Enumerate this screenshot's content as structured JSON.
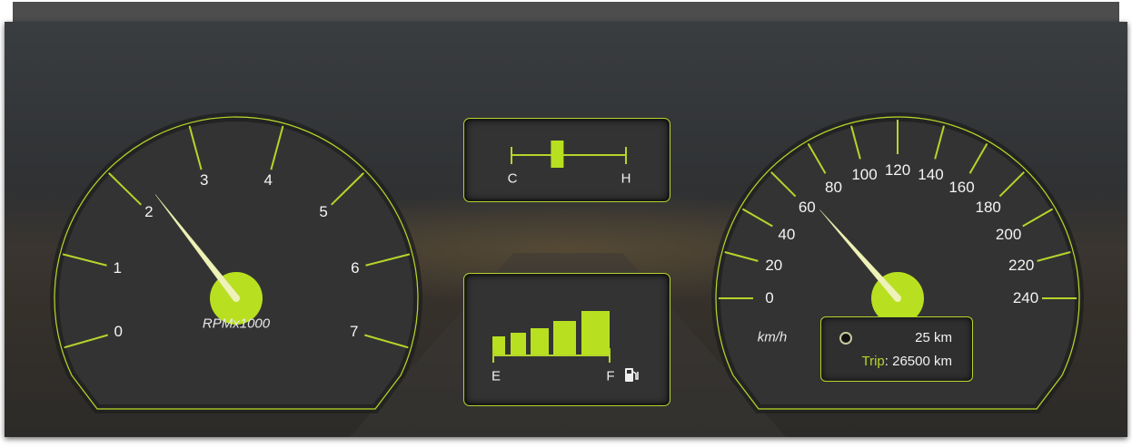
{
  "colors": {
    "accent": "#b5d52a",
    "needle": "#eef2b8",
    "hub": "#b8e020",
    "panel": "#333333"
  },
  "tachometer": {
    "ticks": [
      "0",
      "1",
      "2",
      "3",
      "4",
      "5",
      "6",
      "7"
    ],
    "unit_label": "RPMx1000",
    "needle_value": 2.25
  },
  "temperature": {
    "cold_label": "C",
    "hot_label": "H",
    "level": 0.4
  },
  "fuel": {
    "empty_label": "E",
    "full_label": "F",
    "icon": "fuel-pump-icon",
    "bars_filled": 5
  },
  "speedometer": {
    "ticks": [
      "0",
      "20",
      "40",
      "60",
      "80",
      "100",
      "120",
      "140",
      "160",
      "180",
      "200",
      "220",
      "240"
    ],
    "unit_label": "km/h",
    "needle_value": 65
  },
  "odometer": {
    "distance": "25 km",
    "trip_label": "Trip",
    "trip_value": ": 26500 km"
  }
}
